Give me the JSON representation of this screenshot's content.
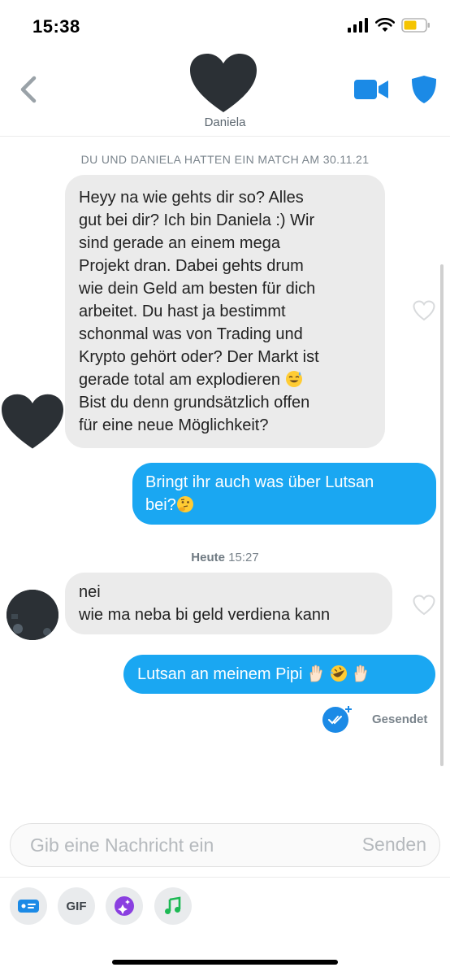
{
  "status_bar": {
    "time": "15:38"
  },
  "header": {
    "name": "Daniela"
  },
  "match_info": "DU UND DANIELA HATTEN EIN MATCH AM 30.11.21",
  "messages": [
    {
      "direction": "incoming",
      "text": "Heyy na wie gehts dir so? Alles\ngut bei dir? Ich bin Daniela :) Wir\nsind gerade an einem mega\nProjekt dran. Dabei gehts drum\nwie dein Geld am besten für dich\narbeitet.  Du hast ja bestimmt\nschonmal was von Trading und\nKrypto gehört oder? Der Markt ist\ngerade total am explodieren",
      "text_after_emoji": "Bist du denn grundsätzlich offen\nfür eine neue Möglichkeit?",
      "emoji": "sweat-smile-emoji"
    },
    {
      "direction": "outgoing",
      "text": "Bringt ihr auch was über Lutsan\nbei?",
      "emoji": "thinking-face-emoji"
    },
    {
      "direction": "incoming",
      "text": "nei\nwie ma neba bi geld verdiena kann"
    },
    {
      "direction": "outgoing",
      "text": "Lutsan an meinem Pipi",
      "emoji": [
        "raised-hand-emoji",
        "rofl-emoji",
        "raised-hand-emoji"
      ]
    }
  ],
  "timestamp": {
    "day": "Heute",
    "time": "15:27"
  },
  "delivery_status": "Gesendet",
  "composer": {
    "placeholder": "Gib eine Nachricht ein",
    "send_label": "Senden"
  },
  "toolbar": {
    "gif_label": "GIF"
  },
  "colors": {
    "accent_blue": "#1aa7f2",
    "incoming_bubble": "#ebebeb",
    "icon_blue": "#1b8ae6"
  }
}
